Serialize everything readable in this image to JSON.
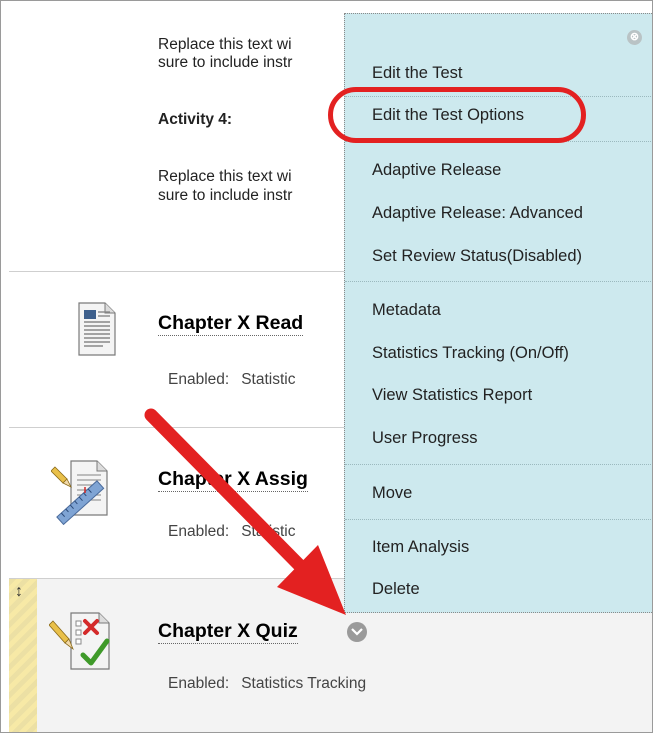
{
  "page": {
    "text_line1": "Replace this text wi",
    "text_line2": "sure to include instr",
    "activity_heading": "Activity 4:",
    "text2_line1": "Replace this text wi",
    "text2_line2": "sure to include instr"
  },
  "items": [
    {
      "title": "Chapter X Read",
      "meta_label": "Enabled:",
      "meta_value": "Statistic",
      "icon": "document-icon"
    },
    {
      "title": "Chapter X Assig",
      "meta_label": "Enabled:",
      "meta_value": "Statistic",
      "icon": "assignment-icon"
    },
    {
      "title": "Chapter X Quiz",
      "meta_label": "Enabled:",
      "meta_value": "Statistics Tracking",
      "icon": "quiz-icon"
    }
  ],
  "drag_handle": "↕",
  "menu": {
    "close_label": "⊗",
    "items": [
      "Edit the Test",
      "Edit the Test Options",
      "Adaptive Release",
      "Adaptive Release: Advanced",
      "Set Review Status(Disabled)",
      "Metadata",
      "Statistics Tracking (On/Off)",
      "View Statistics Report",
      "User Progress",
      "Move",
      "Item Analysis",
      "Delete"
    ],
    "highlighted_item": "Edit the Test Options"
  },
  "colors": {
    "menu_bg": "#cde9ee",
    "highlight_ring": "#e32121",
    "arrow": "#e32121",
    "row_highlight": "#f3f3f3"
  }
}
